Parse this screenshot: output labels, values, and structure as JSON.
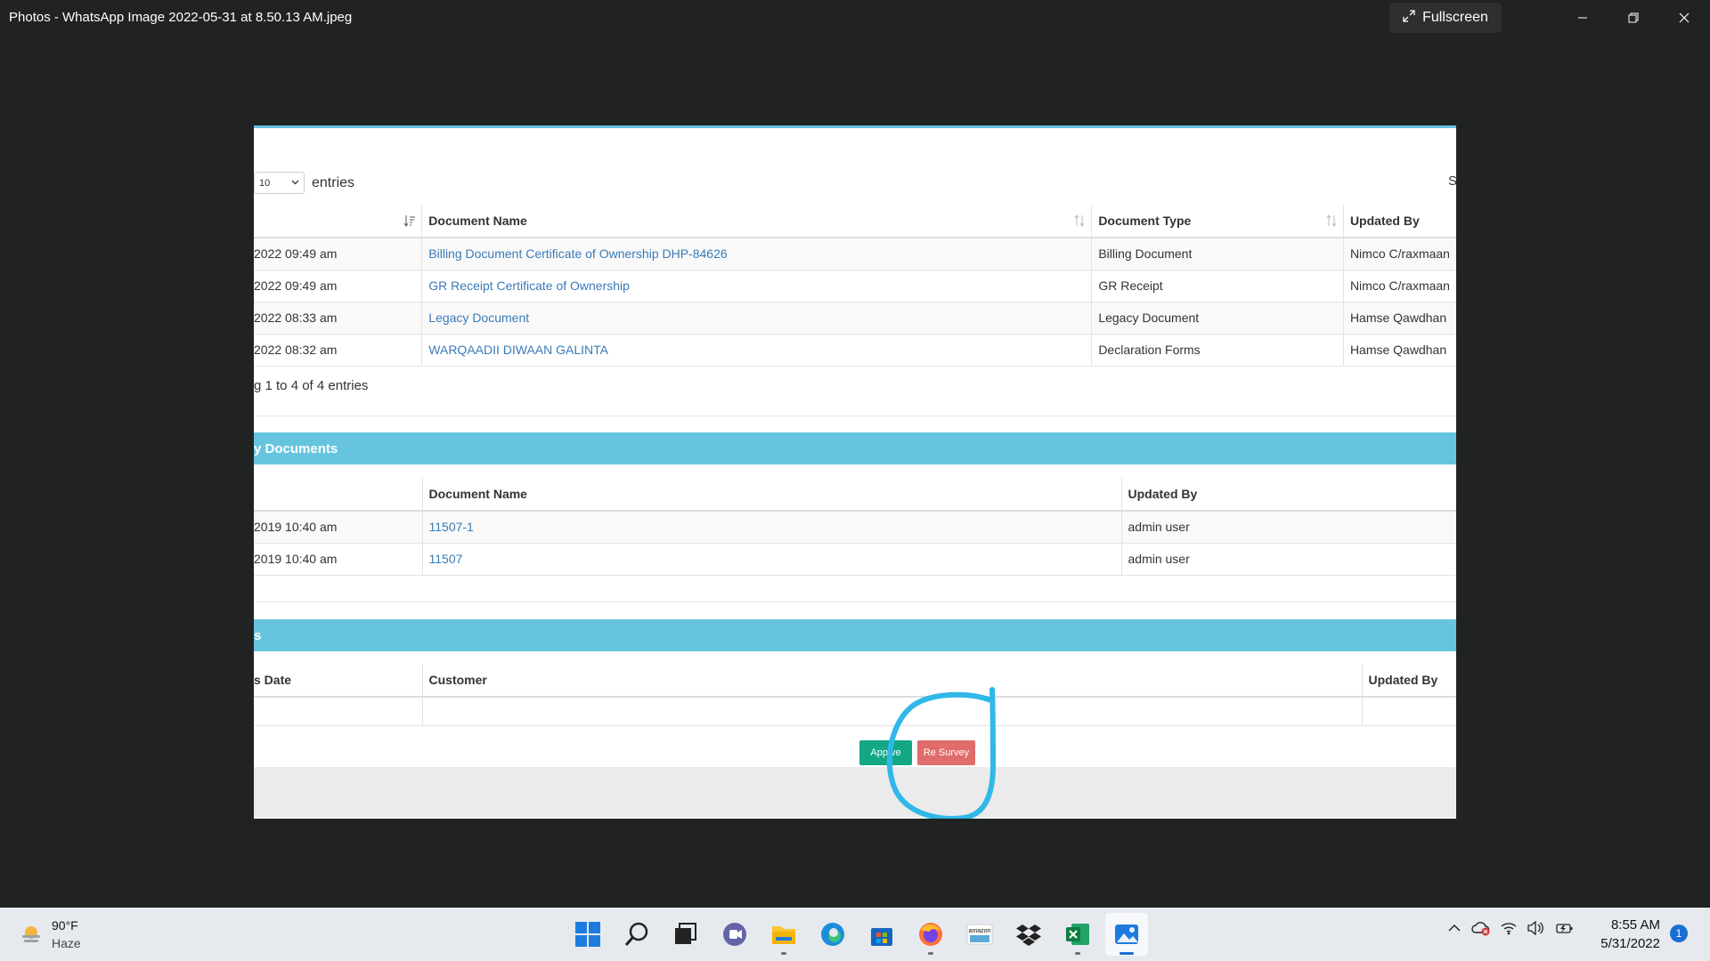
{
  "window": {
    "title": "Photos - WhatsApp Image 2022-05-31 at 8.50.13 AM.jpeg",
    "fullscreen_label": "Fullscreen"
  },
  "photo": {
    "entries_select_value": "10",
    "entries_label": "entries",
    "search_partial": "S",
    "documents_table": {
      "headers": [
        "",
        "Document Name",
        "Document Type",
        "Updated By"
      ],
      "rows": [
        {
          "date": "2022 09:49 am",
          "name": "Billing Document Certificate of Ownership DHP-84626",
          "type": "Billing Document",
          "updated_by": "Nimco C/raxmaan"
        },
        {
          "date": "2022 09:49 am",
          "name": "GR Receipt Certificate of Ownership",
          "type": "GR Receipt",
          "updated_by": "Nimco C/raxmaan"
        },
        {
          "date": "2022 08:33 am",
          "name": "Legacy Document",
          "type": "Legacy Document",
          "updated_by": "Hamse Qawdhan"
        },
        {
          "date": "2022 08:32 am",
          "name": "WARQAADII DIWAAN GALINTA",
          "type": "Declaration Forms",
          "updated_by": "Hamse Qawdhan"
        }
      ],
      "showing": "g 1 to 4 of 4 entries"
    },
    "section2_title": "y Documents",
    "survey_table": {
      "headers": [
        "",
        "Document Name",
        "Updated By"
      ],
      "rows": [
        {
          "date": "2019 10:40 am",
          "name": "11507-1",
          "updated_by": "admin user"
        },
        {
          "date": "2019 10:40 am",
          "name": "11507",
          "updated_by": "admin user"
        }
      ]
    },
    "section3_title": "s",
    "third_table": {
      "headers": [
        "s Date",
        "Customer",
        "Updated By"
      ]
    },
    "approve_label": "App  ve",
    "resurvey_label": "Re Survey",
    "colors": {
      "accent": "#67c4de",
      "approve": "#14a786",
      "resurvey": "#e06c6c",
      "annotation": "#2fb8e8"
    }
  },
  "taskbar": {
    "weather_temp": "90°F",
    "weather_condition": "Haze",
    "clock_time": "8:55 AM",
    "clock_date": "5/31/2022",
    "notification_count": "1",
    "apps": [
      "start-icon",
      "search-icon",
      "task-view-icon",
      "teams-icon",
      "file-explorer-icon",
      "edge-icon",
      "store-icon",
      "firefox-icon",
      "amazon-icon",
      "dropbox-icon",
      "excel-icon",
      "photos-icon"
    ]
  }
}
